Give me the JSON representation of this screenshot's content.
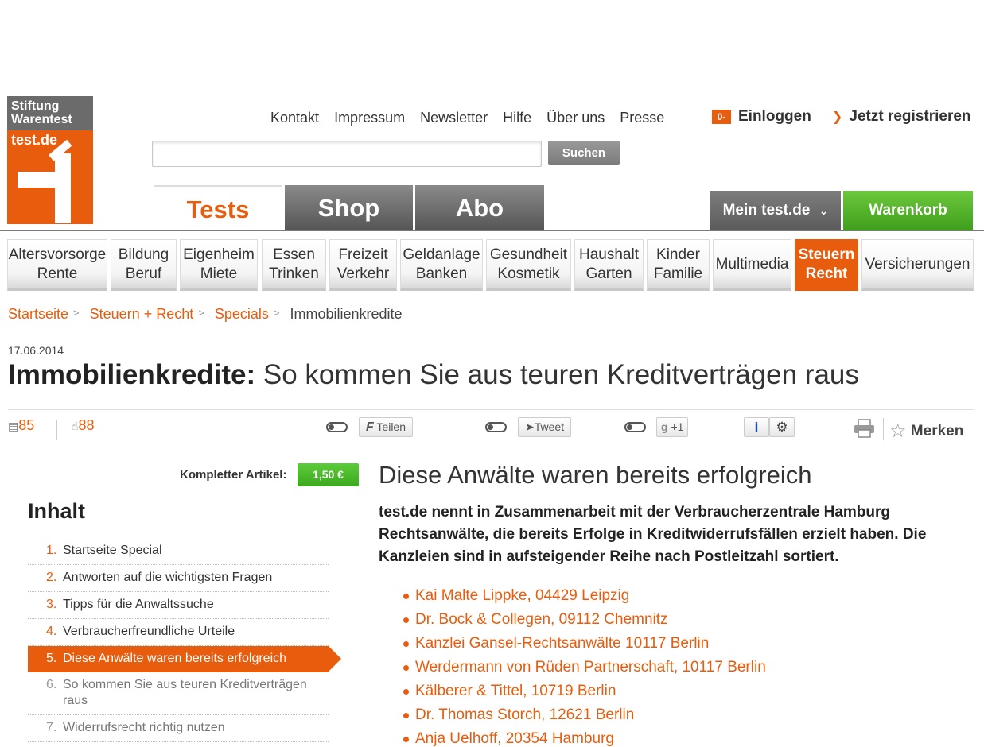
{
  "logo": {
    "line1": "Stiftung",
    "line2": "Warentest",
    "line3": "test.de"
  },
  "toplinks": [
    "Kontakt",
    "Impressum",
    "Newsletter",
    "Hilfe",
    "Über uns",
    "Presse"
  ],
  "account": {
    "login": "Einloggen",
    "register": "Jetzt registrieren",
    "key_symbol": "0-"
  },
  "search": {
    "placeholder": "",
    "button": "Suchen"
  },
  "tabs": [
    "Tests",
    "Shop",
    "Abo"
  ],
  "header_buttons": {
    "mein": "Mein test.de",
    "cart": "Warenkorb"
  },
  "categories": [
    [
      "Altersvorsorge",
      "Rente"
    ],
    [
      "Bildung",
      "Beruf"
    ],
    [
      "Eigenheim",
      "Miete"
    ],
    [
      "Essen",
      "Trinken"
    ],
    [
      "Freizeit",
      "Verkehr"
    ],
    [
      "Geldanlage",
      "Banken"
    ],
    [
      "Gesundheit",
      "Kosmetik"
    ],
    [
      "Haushalt",
      "Garten"
    ],
    [
      "Kinder",
      "Familie"
    ],
    [
      "Multimedia"
    ],
    [
      "Steuern",
      "Recht"
    ],
    [
      "Versicherungen"
    ]
  ],
  "breadcrumb": {
    "items": [
      "Startseite",
      "Steuern + Recht",
      "Specials"
    ],
    "current": "Immobilienkredite"
  },
  "article": {
    "date": "17.06.2014",
    "title_bold": "Immobilienkredite:",
    "title_rest": " So kommen Sie aus teuren Kreditverträgen raus"
  },
  "social": {
    "comments": "85",
    "likes": "88",
    "share": "Teilen",
    "tweet": "Tweet",
    "plus": "+1",
    "bookmark": "Merken"
  },
  "purchase": {
    "label": "Kompletter Artikel:",
    "price": "1,50 €"
  },
  "toc": {
    "title": "Inhalt",
    "items": [
      {
        "num": "1.",
        "label": "Startseite Special"
      },
      {
        "num": "2.",
        "label": "Antworten auf die wichtigsten Fragen"
      },
      {
        "num": "3.",
        "label": "Tipps für die Anwaltssuche"
      },
      {
        "num": "4.",
        "label": "Verbraucherfreundliche Urteile"
      },
      {
        "num": "5.",
        "label": "Diese Anwälte waren bereits erfolgreich"
      },
      {
        "num": "6.",
        "label": "So kommen Sie aus teuren Kreditverträgen raus"
      },
      {
        "num": "7.",
        "label": "Widerrufsrecht richtig nutzen"
      }
    ]
  },
  "section": {
    "title": "Diese Anwälte waren bereits erfolgreich",
    "intro": "test.de nennt in Zusammenarbeit mit der Verbraucherzentrale Hamburg Rechtsanwälte, die bereits Erfolge in Kreditwiderrufsfällen erzielt haben. Die Kanzleien sind in aufsteigender Reihe nach Postleitzahl sortiert.",
    "lawyers": [
      "Kai Malte Lippke, 04429 Leipzig",
      "Dr. Bock & Collegen, 09112 Chemnitz",
      "Kanzlei Gansel-Rechtsanwälte 10117 Berlin",
      "Werdermann von Rüden Partnerschaft, 10117 Berlin",
      "Kälberer & Tittel, 10719 Berlin",
      "Dr. Thomas Storch, 12621 Berlin",
      "Anja Uelhoff, 20354 Hamburg"
    ]
  },
  "colors": {
    "accent": "#e85d0d",
    "green": "#4caf26",
    "grey": "#6b6b6b"
  }
}
